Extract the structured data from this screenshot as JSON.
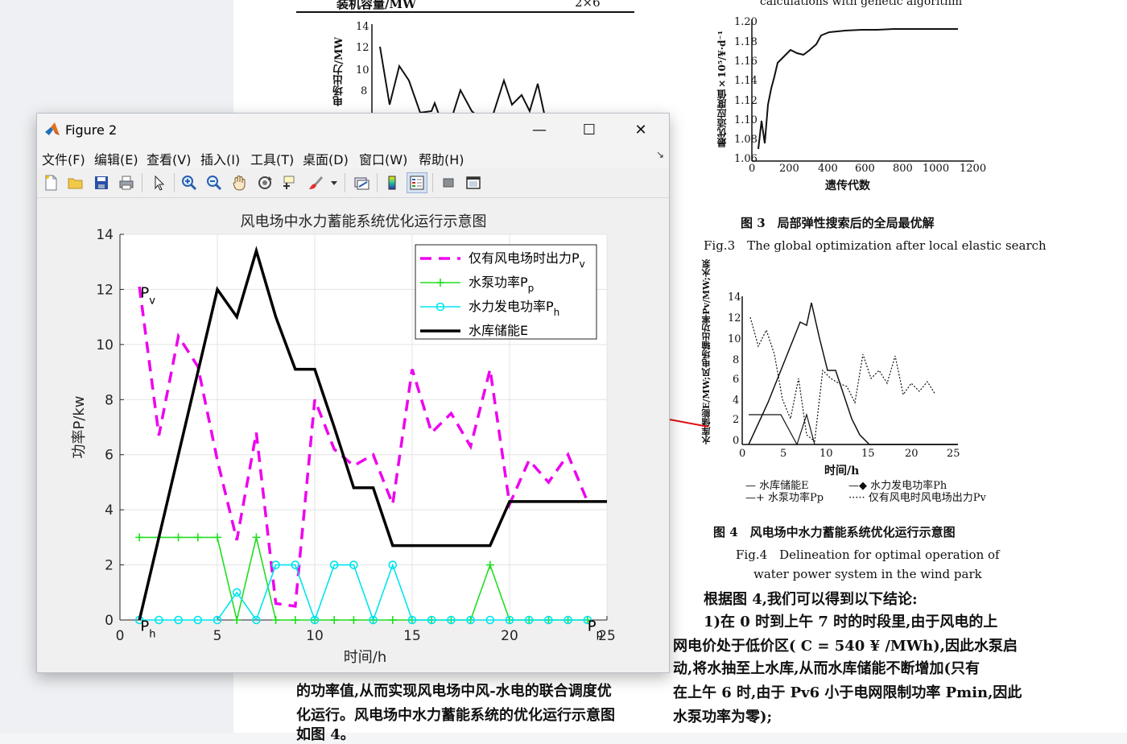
{
  "window": {
    "title": "Figure 2",
    "minimize_glyph": "—",
    "maximize_glyph": "☐",
    "close_glyph": "✕"
  },
  "menu": [
    "文件(F)",
    "编辑(E)",
    "查看(V)",
    "插入(I)",
    "工具(T)",
    "桌面(D)",
    "窗口(W)",
    "帮助(H)"
  ],
  "toolbar_icons": [
    "new-figure-icon",
    "open-file-icon",
    "save-icon",
    "print-icon",
    "pointer-icon",
    "zoom-in-icon",
    "zoom-out-icon",
    "pan-hand-icon",
    "rotate-3d-icon",
    "data-cursor-icon",
    "brush-icon",
    "dropdown-arrow-icon",
    "link-plot-icon",
    "colorbar-icon",
    "legend-icon",
    "hide-plot-tools-icon",
    "show-plot-tools-icon"
  ],
  "colors": {
    "pv": "#ee00ee",
    "pp": "#22dd22",
    "ph": "#00e5ee",
    "e": "#000000",
    "arrow": "#e01010"
  },
  "chart_data": {
    "type": "line",
    "title": "风电场中水力蓄能系统优化运行示意图",
    "xlabel": "时间/h",
    "ylabel": "功率P/kw",
    "xlim": [
      0,
      25
    ],
    "ylim": [
      0,
      14
    ],
    "xticks": [
      0,
      5,
      10,
      15,
      20,
      25
    ],
    "yticks": [
      0,
      2,
      4,
      6,
      8,
      10,
      12,
      14
    ],
    "grid": true,
    "legend_position": "top-right",
    "annotations": [
      {
        "text": "P",
        "sub": "v",
        "x": 1.05,
        "y": 11.7
      },
      {
        "text": "P",
        "sub": "h",
        "x": 1.05,
        "y": -0.4
      },
      {
        "text": "P",
        "sub": "p",
        "x": 24.0,
        "y": -0.4
      }
    ],
    "x": [
      1,
      2,
      3,
      4,
      5,
      6,
      7,
      8,
      9,
      10,
      11,
      12,
      13,
      14,
      15,
      16,
      17,
      18,
      19,
      20,
      21,
      22,
      23,
      24,
      25
    ],
    "series": [
      {
        "name": "仅有风电场时出力P",
        "name_sub": "v",
        "style": "dashed",
        "marker": "none",
        "values": [
          12.1,
          6.7,
          10.3,
          9.2,
          5.8,
          2.9,
          6.8,
          0.6,
          0.5,
          8.0,
          6.2,
          5.6,
          6.0,
          4.2,
          9.1,
          6.8,
          7.5,
          6.3,
          9.1,
          4.2,
          5.8,
          5.0,
          6.0,
          4.3,
          null
        ]
      },
      {
        "name": "水泵功率P",
        "name_sub": "p",
        "style": "solid",
        "marker": "plus",
        "values": [
          3,
          3,
          3,
          3,
          3,
          0,
          3,
          0,
          0,
          0,
          0,
          0,
          0,
          0,
          0,
          0,
          0,
          0,
          2,
          0,
          0,
          0,
          0,
          0,
          null
        ]
      },
      {
        "name": "水力发电功率P",
        "name_sub": "h",
        "style": "solid",
        "marker": "circle",
        "values": [
          0,
          0,
          0,
          0,
          0,
          1,
          0,
          2,
          2,
          0,
          2,
          2,
          0,
          2,
          0,
          0,
          0,
          0,
          0,
          0,
          0,
          0,
          0,
          0,
          null
        ]
      },
      {
        "name": "水库储能E",
        "style": "solid-bold",
        "marker": "none",
        "values": [
          0,
          3,
          6,
          9,
          12,
          11,
          13.4,
          11,
          9.1,
          9.1,
          7,
          4.8,
          4.8,
          2.7,
          2.7,
          2.7,
          2.7,
          2.7,
          2.7,
          4.3,
          4.3,
          4.3,
          4.3,
          4.3,
          4.3
        ]
      }
    ]
  },
  "paper": {
    "table_header_left": "装机容量/MW",
    "table_header_right": "2×6",
    "top_caption": "calculations with genetic algorithm",
    "fig3_y_label": "最优适应度值×10⁵/¥·d⁻¹",
    "fig3_yticks": [
      "1.20",
      "1.18",
      "1.16",
      "1.14",
      "1.12",
      "1.10",
      "1.08",
      "1.06"
    ],
    "fig3_xticks": [
      "0",
      "200",
      "400",
      "600",
      "800",
      "1000",
      "1200"
    ],
    "fig3_xlabel": "遗传代数",
    "fig3_caption_cn": "图 3　局部弹性搜索后的全局最优解",
    "fig3_caption_en": "Fig.3　The global optimization after local elastic search",
    "fig4_y_label": "水库储能E/MW;风电场输出功率Pv/MW;水泵功率Pp/MW;水力发电功率Ph/MW",
    "fig4_yticks": [
      "14",
      "12",
      "10",
      "8",
      "6",
      "4",
      "2",
      "0"
    ],
    "fig4_xticks": [
      "0",
      "5",
      "10",
      "15",
      "20",
      "25"
    ],
    "fig4_xlabel": "时间/h",
    "fig4_legend": [
      "— 水库储能E",
      "—◆ 水力发电功率Ph",
      "—+ 水泵功率Pp",
      "····· 仅有风电时风电场出力Pv"
    ],
    "fig4_caption_cn": "图 4　风电场中水力蓄能系统优化运行示意图",
    "fig4_caption_en_1": "Fig.4　Delineation for optimal operation of",
    "fig4_caption_en_2": "water power system in the wind park",
    "bg_yticks": [
      "14",
      "12",
      "10",
      "8"
    ],
    "bg_ylabel": "电场出力/MW",
    "right_text": [
      "根据图 4,我们可以得到以下结论:",
      "1)在 0 时到上午 7 时的时段里,由于风电的上",
      "网电价处于低价区( C = 540 ¥ /MWh),因此水泵启",
      "动,将水抽至上水库,从而水库储能不断增加(只有",
      "在上午 6 时,由于 Pv6 小于电网限制功率 Pmin,因此",
      "水泵功率为零);"
    ],
    "left_text": [
      "的功率值,从而实现风电场中风-水电的联合调度优",
      "化运行。风电场中水力蓄能系统的优化运行示意图",
      "如图 4。"
    ]
  }
}
